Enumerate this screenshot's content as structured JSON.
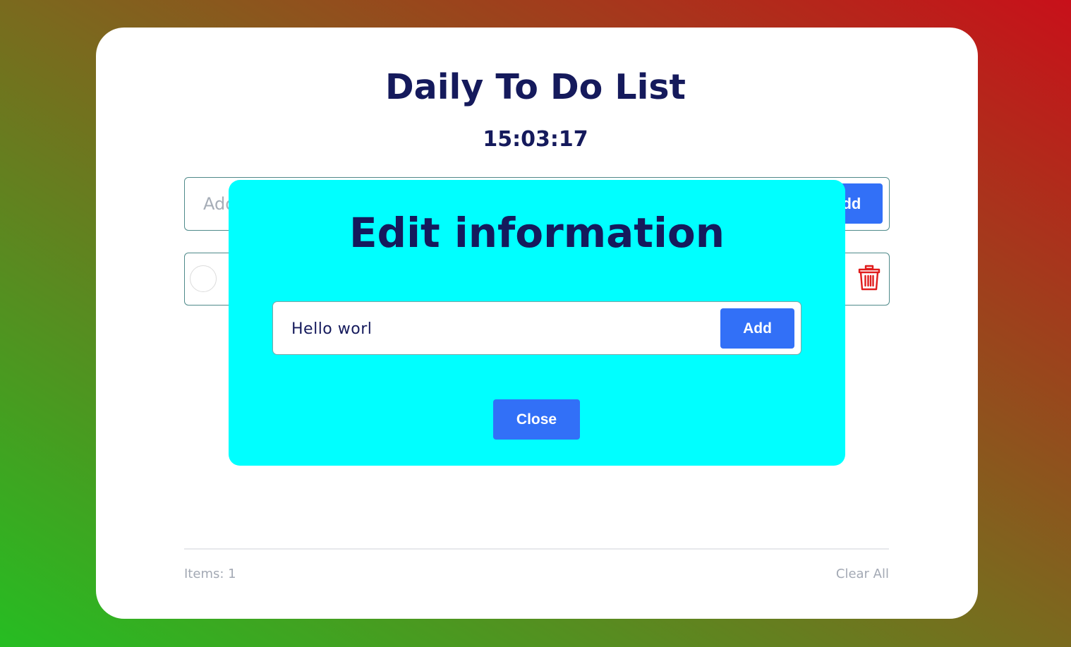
{
  "app": {
    "title": "Daily To Do List",
    "clock": "15:03:17"
  },
  "add_form": {
    "placeholder": "Add new list item",
    "button_label": "Add"
  },
  "todo_items": [
    {
      "text": "Hello worl",
      "completed": false
    }
  ],
  "footer": {
    "items_label": "Items: 1",
    "clear_all_label": "Clear All"
  },
  "modal": {
    "title": "Edit information",
    "input_value": "Hello worl",
    "add_button_label": "Add",
    "close_button_label": "Close"
  },
  "colors": {
    "primary_text": "#151a5c",
    "button_blue": "#3270f7",
    "modal_bg": "#00ffff",
    "delete_red": "#e01c1c",
    "gradient_start": "#26bd22",
    "gradient_end": "#c8101a"
  },
  "icons": {
    "delete": "trash-icon",
    "check": "circle-check-icon"
  }
}
